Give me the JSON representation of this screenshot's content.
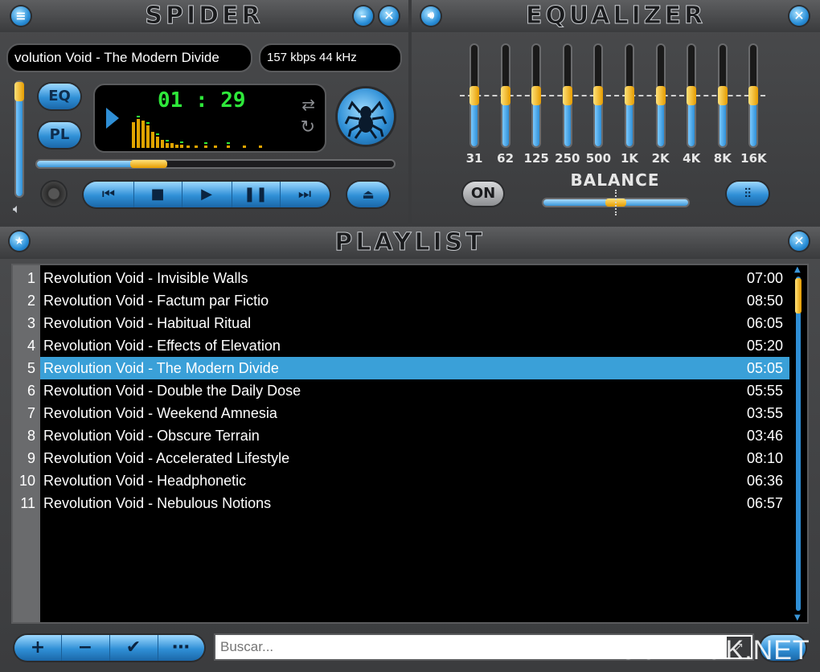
{
  "player": {
    "title": "SPIDER",
    "track_display": "volution Void - The Modern Divide",
    "bitrate_display": "157 kbps 44 kHz",
    "time": "01 : 29",
    "eq_button": "EQ",
    "pl_button": "PL",
    "seek_fraction": 0.31,
    "volume_fraction": 0.92
  },
  "equalizer": {
    "title": "EQUALIZER",
    "on_button": "ON",
    "balance_label": "BALANCE",
    "balance_value": 0,
    "bands": [
      {
        "label": "31",
        "level": 0.5
      },
      {
        "label": "62",
        "level": 0.5
      },
      {
        "label": "125",
        "level": 0.5
      },
      {
        "label": "250",
        "level": 0.5
      },
      {
        "label": "500",
        "level": 0.5
      },
      {
        "label": "1K",
        "level": 0.5
      },
      {
        "label": "2K",
        "level": 0.5
      },
      {
        "label": "4K",
        "level": 0.5
      },
      {
        "label": "8K",
        "level": 0.5
      },
      {
        "label": "16K",
        "level": 0.5
      }
    ]
  },
  "playlist": {
    "title": "PLAYLIST",
    "search_placeholder": "Buscar...",
    "selected_index": 4,
    "tracks": [
      {
        "num": "1",
        "title": "Revolution Void - Invisible Walls",
        "duration": "07:00"
      },
      {
        "num": "2",
        "title": "Revolution Void - Factum par Fictio",
        "duration": "08:50"
      },
      {
        "num": "3",
        "title": "Revolution Void - Habitual Ritual",
        "duration": "06:05"
      },
      {
        "num": "4",
        "title": "Revolution Void - Effects of Elevation",
        "duration": "05:20"
      },
      {
        "num": "5",
        "title": "Revolution Void - The Modern Divide",
        "duration": "05:05"
      },
      {
        "num": "6",
        "title": "Revolution Void - Double the Daily Dose",
        "duration": "05:55"
      },
      {
        "num": "7",
        "title": "Revolution Void - Weekend Amnesia",
        "duration": "03:55"
      },
      {
        "num": "8",
        "title": "Revolution Void - Obscure Terrain",
        "duration": "03:46"
      },
      {
        "num": "9",
        "title": "Revolution Void - Accelerated Lifestyle",
        "duration": "08:10"
      },
      {
        "num": "10",
        "title": "Revolution Void - Headphonetic",
        "duration": "06:36"
      },
      {
        "num": "11",
        "title": "Revolution Void - Nebulous Notions",
        "duration": "06:57"
      }
    ]
  },
  "watermark": "SOFT-OK.NET",
  "colors": {
    "accent": "#2f8fd6",
    "highlight": "#3aa0d8",
    "lcd_green": "#2ee83a",
    "knob": "#f0a800"
  }
}
